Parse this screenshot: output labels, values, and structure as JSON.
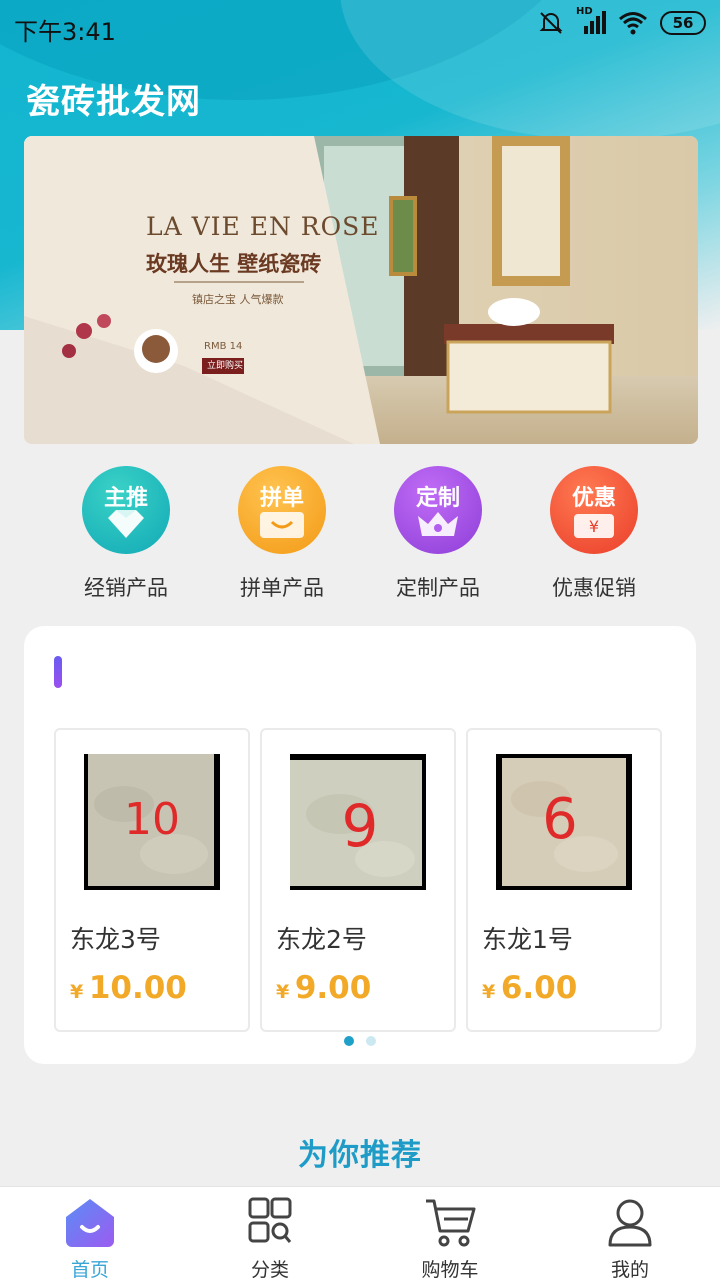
{
  "status_bar": {
    "time": "下午3:41",
    "network": "HD",
    "battery": "56"
  },
  "header": {
    "title": "瓷砖批发网"
  },
  "banner": {
    "headline_en": "LA VIE EN ROSE",
    "headline_cn": "玫瑰人生 壁纸瓷砖",
    "subtitle": "镇店之宝 人气爆款",
    "price_text": "RMB 14",
    "cta": "立即购买"
  },
  "quick_links": [
    {
      "tag": "主推",
      "label": "经销产品",
      "icon": "diamond-icon",
      "color": "#19b8b4"
    },
    {
      "tag": "拼单",
      "label": "拼单产品",
      "icon": "smile-bag-icon",
      "color": "#f6a623"
    },
    {
      "tag": "定制",
      "label": "定制产品",
      "icon": "crown-icon",
      "color": "#a44ee8"
    },
    {
      "tag": "优惠",
      "label": "优惠促销",
      "icon": "coupon-yen-icon",
      "color": "#f2563a"
    }
  ],
  "featured": {
    "products": [
      {
        "name": "东龙3号",
        "currency": "¥",
        "price": "10.00",
        "tile_number": "10",
        "tile_color": "#c8c4b4"
      },
      {
        "name": "东龙2号",
        "currency": "¥",
        "price": "9.00",
        "tile_number": "9",
        "tile_color": "#cfcfbf"
      },
      {
        "name": "东龙1号",
        "currency": "¥",
        "price": "6.00",
        "tile_number": "6",
        "tile_color": "#d6cdb8"
      }
    ],
    "page_count": 2,
    "active_page": 1
  },
  "recommend": {
    "title": "为你推荐"
  },
  "tab_bar": {
    "tabs": [
      {
        "label": "首页",
        "icon": "home-icon",
        "active": true
      },
      {
        "label": "分类",
        "icon": "category-grid-icon",
        "active": false
      },
      {
        "label": "购物车",
        "icon": "cart-icon",
        "active": false
      },
      {
        "label": "我的",
        "icon": "user-icon",
        "active": false
      }
    ]
  },
  "colors": {
    "brand": "#17b7d0",
    "price": "#f2a928",
    "accent_tab": "#3aa6d6",
    "recommend": "#1e9cc7"
  }
}
